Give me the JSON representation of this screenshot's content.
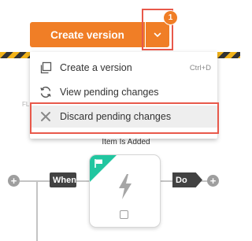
{
  "toolbar": {
    "create_version_label": "Create version",
    "pending_count": "1",
    "accent_color": "#f07e26",
    "dropdown_icon": "chevron-down-icon"
  },
  "menu": {
    "items": [
      {
        "label": "Create a version",
        "shortcut": "Ctrl+D",
        "icon": "copy-icon"
      },
      {
        "label": "View pending changes",
        "icon": "sync-icon"
      },
      {
        "label": "Discard pending changes",
        "icon": "close-icon"
      }
    ]
  },
  "canvas": {
    "faint_label": "FL",
    "trigger": {
      "title": "Item Is Added",
      "icon": "bolt-icon",
      "badge_icon": "flag-icon",
      "badge_color": "#21c6a0"
    },
    "when_label": "When",
    "do_label": "Do",
    "add_glyph": "+"
  },
  "highlight_color": "#e8594b"
}
